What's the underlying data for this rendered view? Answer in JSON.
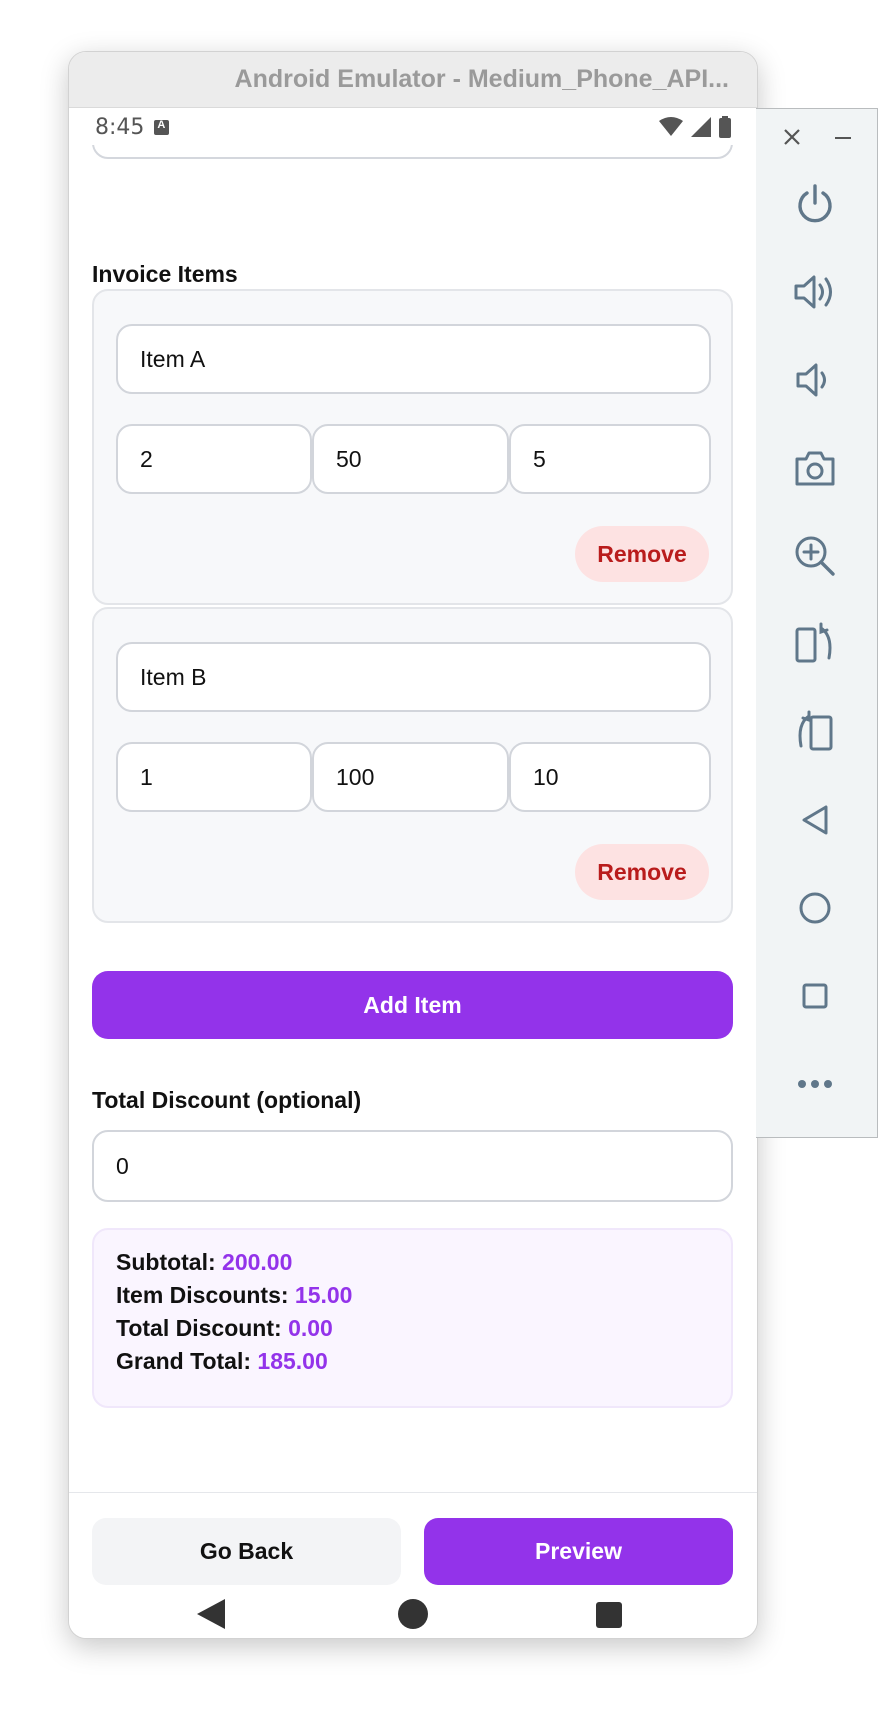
{
  "window": {
    "title": "Android Emulator - Medium_Phone_API..."
  },
  "status_bar": {
    "time": "8:45"
  },
  "invoice": {
    "section_label": "Invoice Items",
    "items": [
      {
        "name": "Item A",
        "quantity": "2",
        "price": "50",
        "discount": "5",
        "remove_label": "Remove"
      },
      {
        "name": "Item B",
        "quantity": "1",
        "price": "100",
        "discount": "10",
        "remove_label": "Remove"
      }
    ],
    "add_item_label": "Add Item"
  },
  "total_discount": {
    "label": "Total Discount (optional)",
    "value": "0"
  },
  "summary": {
    "subtotal_label": "Subtotal:",
    "subtotal": "200.00",
    "item_discounts_label": "Item Discounts:",
    "item_discounts": "15.00",
    "total_discount_label": "Total Discount:",
    "total_discount": "0.00",
    "grand_total_label": "Grand Total:",
    "grand_total": "185.00"
  },
  "footer": {
    "back_label": "Go Back",
    "preview_label": "Preview"
  },
  "side_panel": {
    "icons": [
      "close-icon",
      "minimize-icon",
      "power-icon",
      "volume-up-icon",
      "volume-down-icon",
      "camera-icon",
      "zoom-icon",
      "rotate-left-icon",
      "rotate-right-icon",
      "back-icon",
      "home-icon",
      "overview-icon",
      "more-icon"
    ]
  },
  "colors": {
    "accent": "#9333ea",
    "remove_bg": "#fde2e2",
    "remove_text": "#b91c1c"
  }
}
